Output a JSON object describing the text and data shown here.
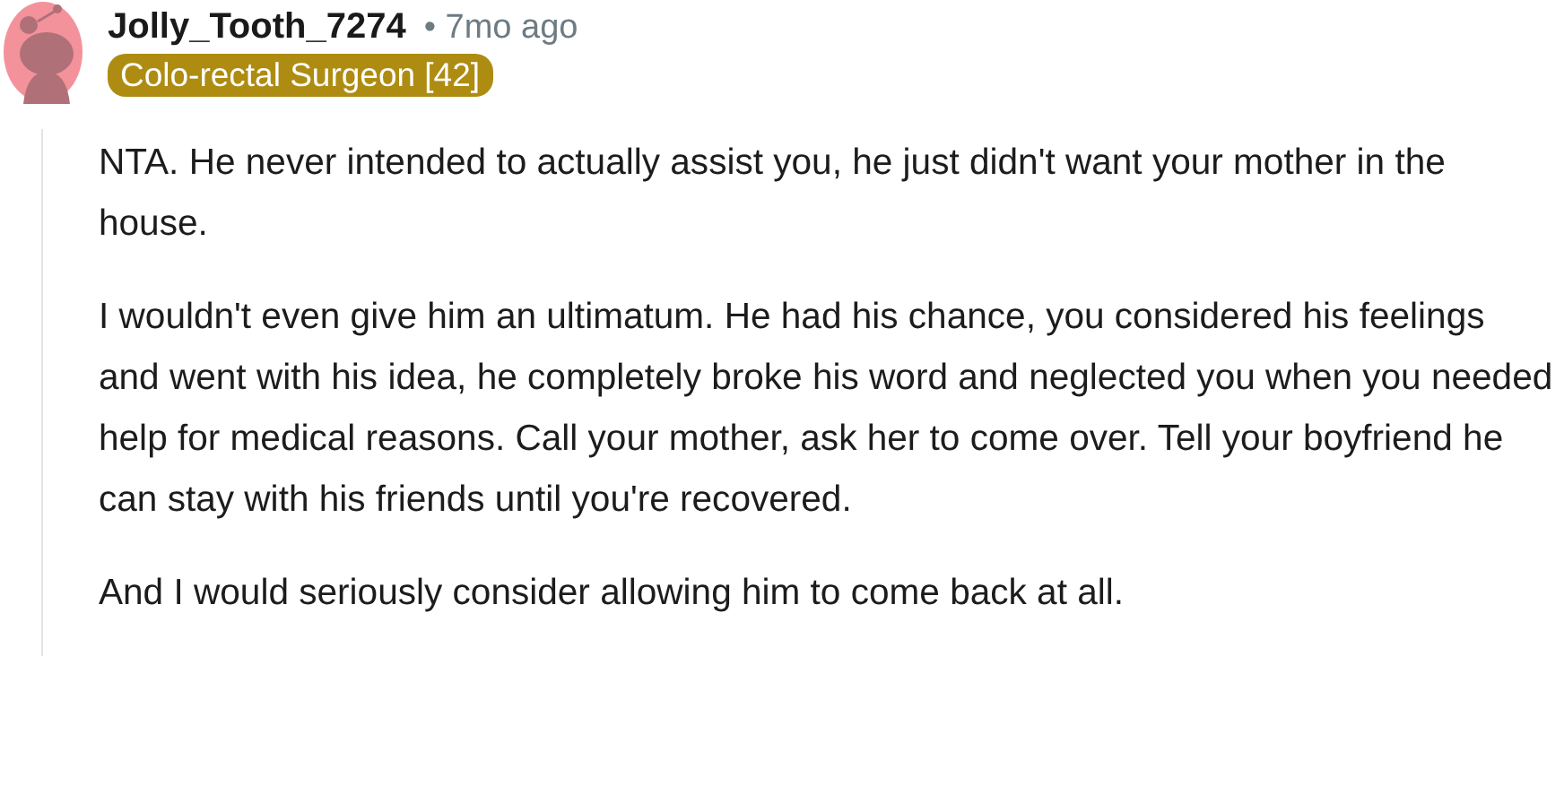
{
  "comment": {
    "author": "Jolly_Tooth_7274",
    "time": "• 7mo ago",
    "flair": "Colo-rectal Surgeon [42]",
    "paragraphs": [
      "NTA. He never intended to actually assist you, he just didn't want your mother in the house.",
      "I wouldn't even give him an ultimatum. He had his chance, you considered his feelings and went with his idea, he completely broke his word and neglected you when you needed help for medical reasons. Call your mother, ask her to come over. Tell your boyfriend he can stay with his friends until you're recovered.",
      "And I would seriously consider allowing him to come back at all."
    ]
  }
}
